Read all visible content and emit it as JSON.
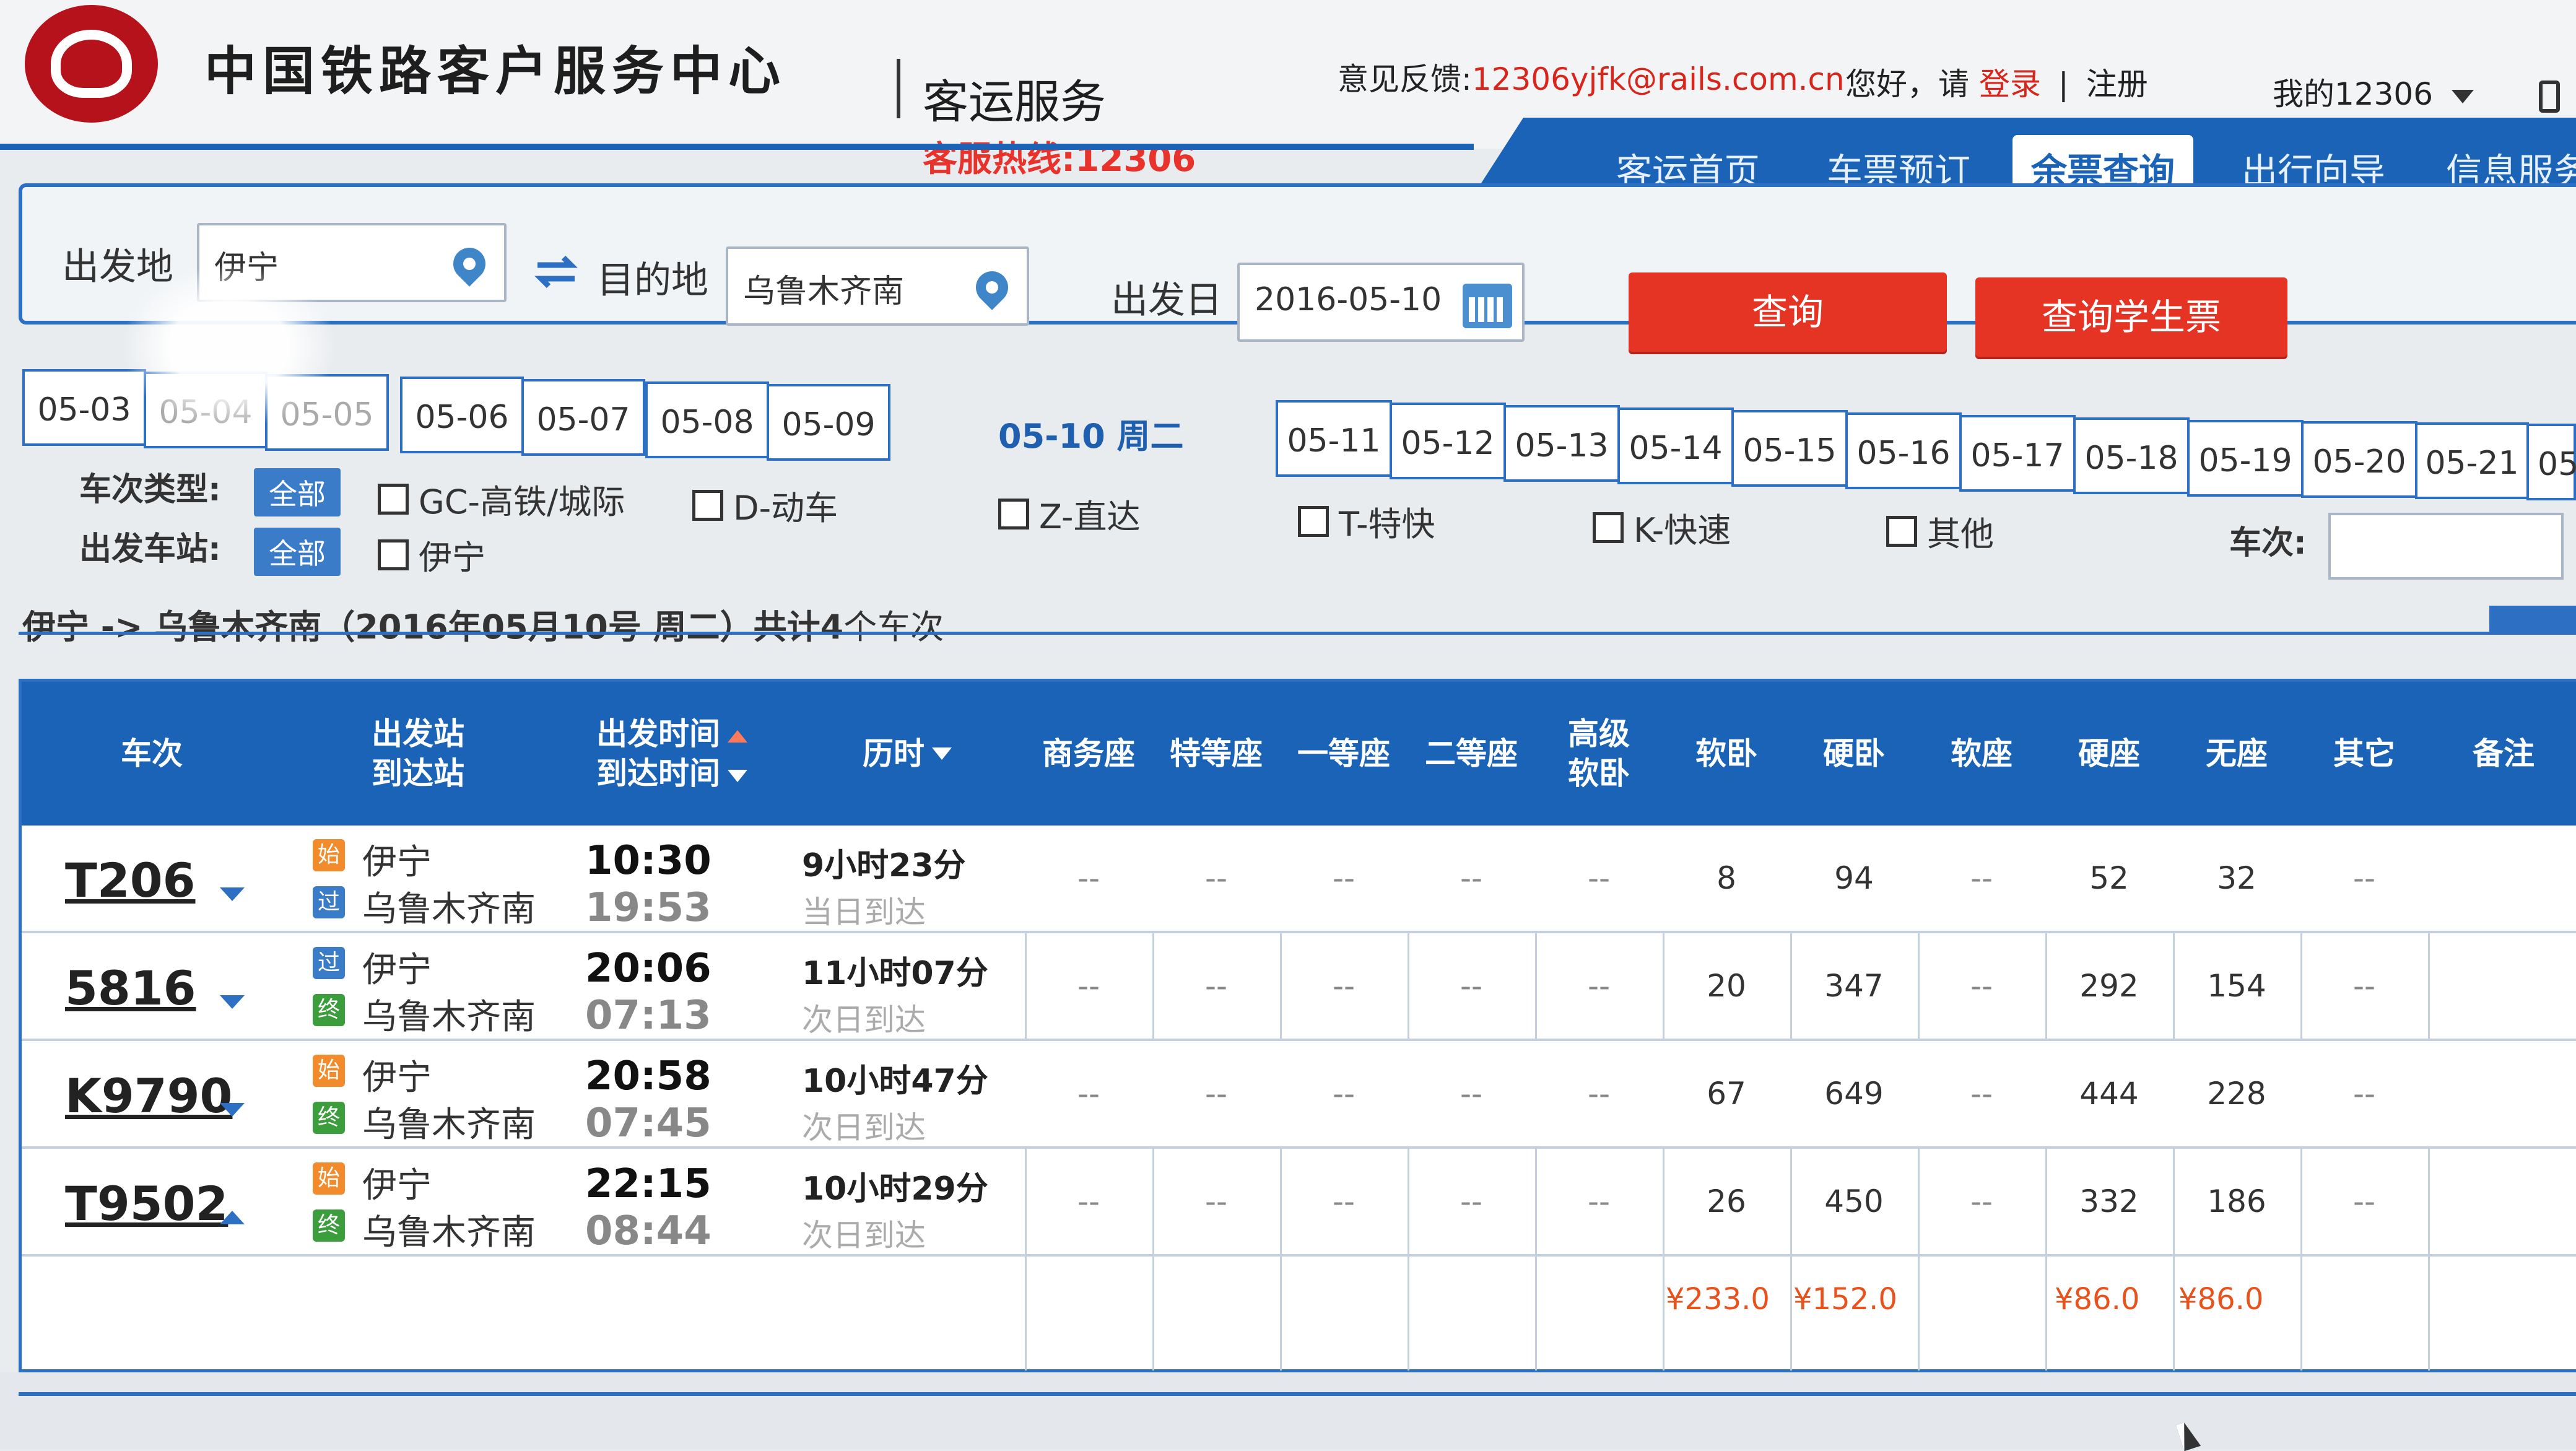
{
  "header": {
    "org_title": "中国铁路客户服务中心",
    "service_title": "客运服务",
    "hotline": "客服热线:12306",
    "feedback_label": "意见反馈:",
    "feedback_email": "12306yjfk@rails.com.cn",
    "greeting": "您好，请",
    "login": "登录",
    "separator": "|",
    "register": "注册",
    "my_account": "我的12306"
  },
  "nav": {
    "items": [
      {
        "label": "客运首页"
      },
      {
        "label": "车票预订"
      },
      {
        "label": "余票查询"
      },
      {
        "label": "出行向导"
      },
      {
        "label": "信息服务"
      }
    ],
    "active_index": 2
  },
  "search": {
    "from_label": "出发地",
    "from_value": "伊宁",
    "to_label": "目的地",
    "to_value": "乌鲁木齐南",
    "date_label": "出发日",
    "date_value": "2016-05-10",
    "query_button": "查询",
    "student_button": "查询学生票"
  },
  "date_tabs": {
    "before": [
      "05-03",
      "05-04",
      "05-05",
      "05-06",
      "05-07",
      "05-08",
      "05-09"
    ],
    "selected": "05-10 周二",
    "after": [
      "05-11",
      "05-12",
      "05-13",
      "05-14",
      "05-15",
      "05-16",
      "05-17",
      "05-18",
      "05-19",
      "05-20",
      "05-21",
      "05"
    ]
  },
  "filters": {
    "train_type_label": "车次类型:",
    "all_label": "全部",
    "types": [
      "GC-高铁/城际",
      "D-动车",
      "Z-直达",
      "T-特快",
      "K-快速",
      "其他"
    ],
    "station_label": "出发车站:",
    "stations": [
      "伊宁"
    ],
    "train_no_label": "车次:"
  },
  "summary": {
    "route": "伊宁 -> 乌鲁木齐南（2016年05月10号  周二）共计",
    "count": "4",
    "suffix": "个车次"
  },
  "table": {
    "headers": {
      "train": "车次",
      "station_dep": "出发站",
      "station_arr": "到达站",
      "time_dep": "出发时间",
      "time_arr": "到达时间",
      "duration": "历时",
      "business": "商务座",
      "special": "特等座",
      "first": "一等座",
      "second": "二等座",
      "deluxe_1": "高级",
      "deluxe_2": "软卧",
      "soft_sleeper": "软卧",
      "hard_sleeper": "硬卧",
      "soft_seat": "软座",
      "hard_seat": "硬座",
      "no_seat": "无座",
      "other": "其它",
      "remark": "备注"
    },
    "rows": [
      {
        "train": "T206",
        "from": "伊宁",
        "to": "乌鲁木齐南",
        "from_type": "始",
        "to_type": "过",
        "dep": "10:30",
        "arr": "19:53",
        "duration": "9小时23分",
        "arrive_day": "当日到达",
        "business": "--",
        "special": "--",
        "first": "--",
        "second": "--",
        "deluxe": "--",
        "soft_sleeper": "8",
        "hard_sleeper": "94",
        "soft_seat": "--",
        "hard_seat": "52",
        "no_seat": "32",
        "other": "--",
        "expanded": false
      },
      {
        "train": "5816",
        "from": "伊宁",
        "to": "乌鲁木齐南",
        "from_type": "过",
        "to_type": "终",
        "dep": "20:06",
        "arr": "07:13",
        "duration": "11小时07分",
        "arrive_day": "次日到达",
        "business": "--",
        "special": "--",
        "first": "--",
        "second": "--",
        "deluxe": "--",
        "soft_sleeper": "20",
        "hard_sleeper": "347",
        "soft_seat": "--",
        "hard_seat": "292",
        "no_seat": "154",
        "other": "--",
        "expanded": false
      },
      {
        "train": "K9790",
        "from": "伊宁",
        "to": "乌鲁木齐南",
        "from_type": "始",
        "to_type": "终",
        "dep": "20:58",
        "arr": "07:45",
        "duration": "10小时47分",
        "arrive_day": "次日到达",
        "business": "--",
        "special": "--",
        "first": "--",
        "second": "--",
        "deluxe": "--",
        "soft_sleeper": "67",
        "hard_sleeper": "649",
        "soft_seat": "--",
        "hard_seat": "444",
        "no_seat": "228",
        "other": "--",
        "expanded": false
      },
      {
        "train": "T9502",
        "from": "伊宁",
        "to": "乌鲁木齐南",
        "from_type": "始",
        "to_type": "终",
        "dep": "22:15",
        "arr": "08:44",
        "duration": "10小时29分",
        "arrive_day": "次日到达",
        "business": "--",
        "special": "--",
        "first": "--",
        "second": "--",
        "deluxe": "--",
        "soft_sleeper": "26",
        "hard_sleeper": "450",
        "soft_seat": "--",
        "hard_seat": "332",
        "no_seat": "186",
        "other": "--",
        "expanded": true
      }
    ],
    "prices": {
      "soft_sleeper": "¥233.0",
      "hard_sleeper": "¥152.0",
      "hard_seat": "¥86.0",
      "no_seat": "¥86.0"
    }
  },
  "colors": {
    "brand_blue": "#1a63b7",
    "brand_red": "#e63424",
    "logo_red": "#b5121b",
    "price_orange": "#e8521c"
  },
  "icons": [
    "logo-icon",
    "map-pin-icon",
    "swap-icon",
    "calendar-icon",
    "chevron-down-icon",
    "sort-up-icon",
    "sort-down-icon",
    "window-icon"
  ]
}
